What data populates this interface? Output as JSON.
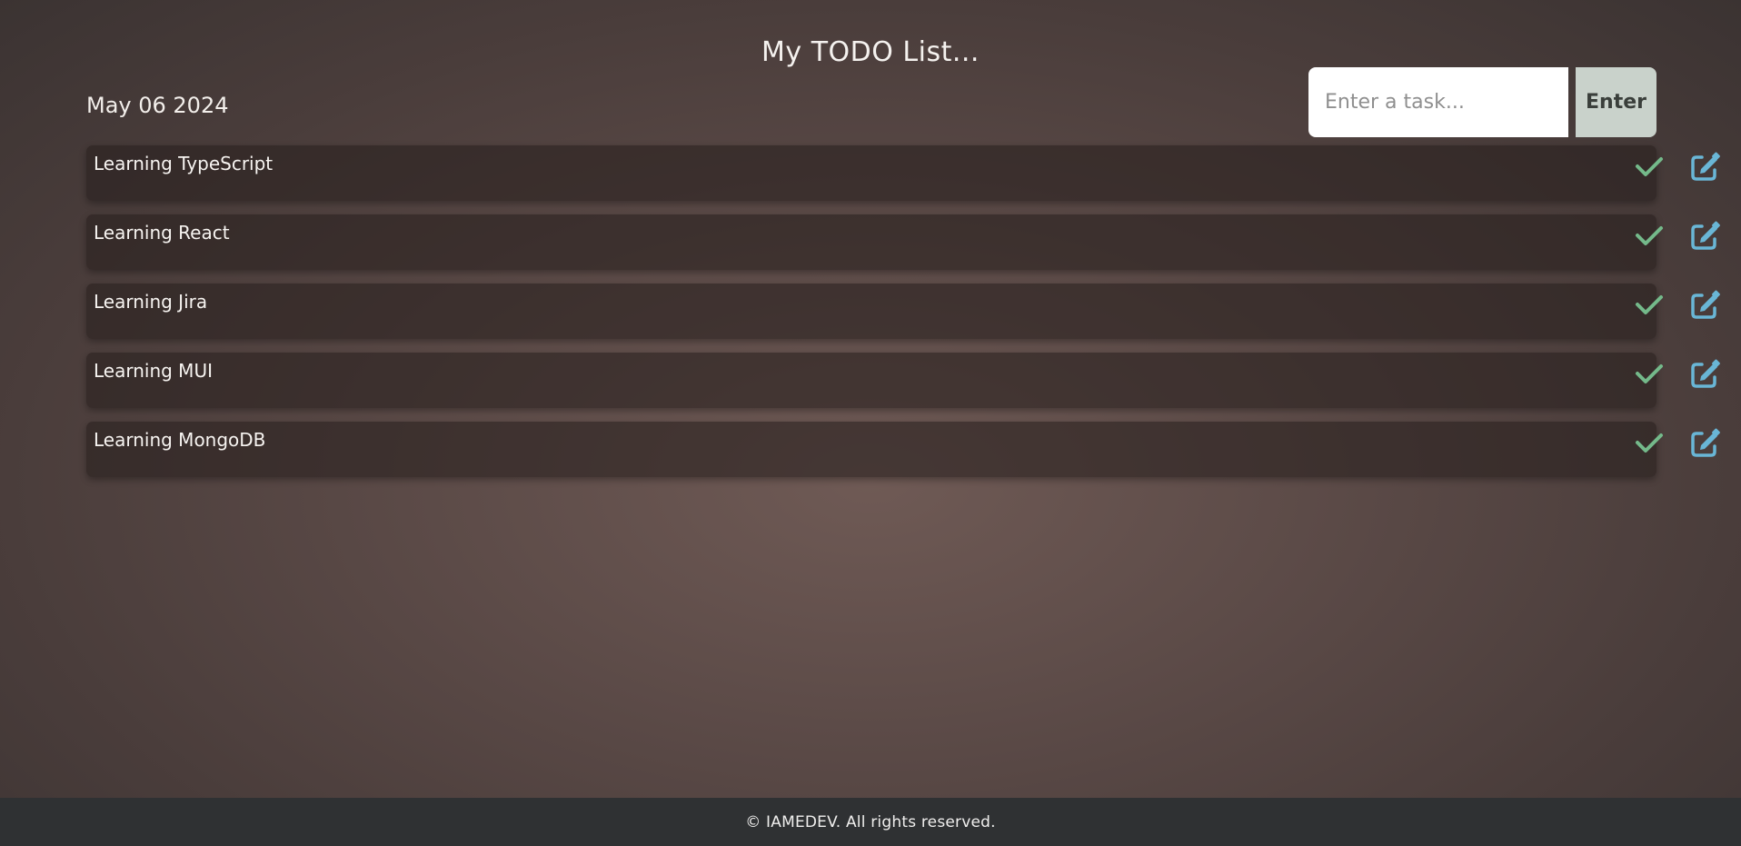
{
  "app": {
    "title": "My TODO List..."
  },
  "header": {
    "date": "May 06 2024"
  },
  "form": {
    "placeholder": "Enter a task...",
    "button_label": "Enter"
  },
  "tasks": [
    {
      "label": "Learning TypeScript"
    },
    {
      "label": "Learning React"
    },
    {
      "label": "Learning Jira"
    },
    {
      "label": "Learning MUI"
    },
    {
      "label": "Learning MongoDB"
    }
  ],
  "icons": {
    "complete": "check-icon",
    "edit": "edit-icon"
  },
  "colors": {
    "check": "#74b98a",
    "edit": "#69b6d6",
    "enter_button": "#c9d2cb",
    "footer": "#2f3133"
  },
  "footer": {
    "text": "© IAMEDEV. All rights reserved."
  }
}
